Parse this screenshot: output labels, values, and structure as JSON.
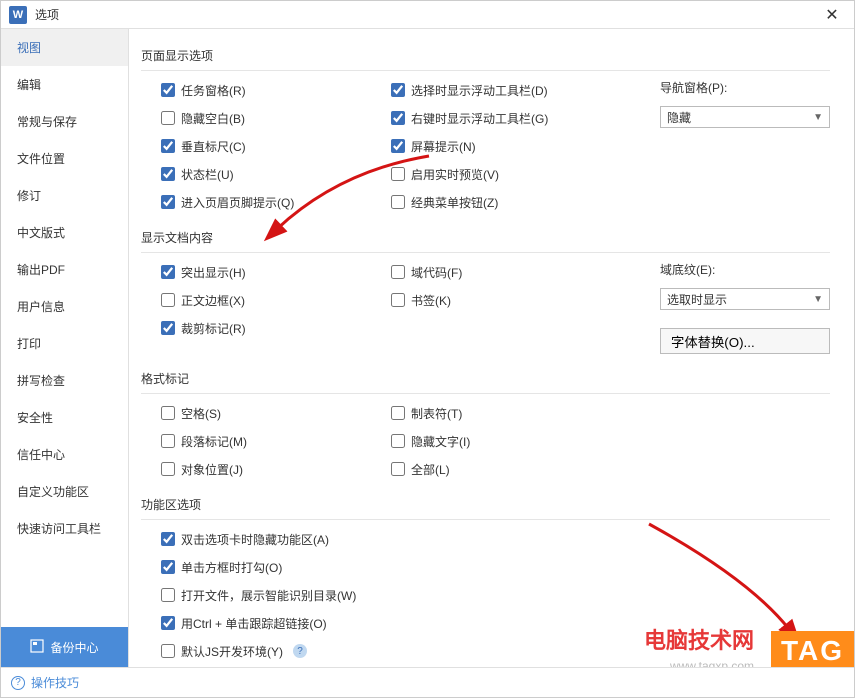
{
  "titlebar": {
    "app_letter": "W",
    "title": "选项",
    "close": "✕"
  },
  "sidebar": {
    "items": [
      {
        "label": "视图",
        "active": true
      },
      {
        "label": "编辑"
      },
      {
        "label": "常规与保存"
      },
      {
        "label": "文件位置"
      },
      {
        "label": "修订"
      },
      {
        "label": "中文版式"
      },
      {
        "label": "输出PDF"
      },
      {
        "label": "用户信息"
      },
      {
        "label": "打印"
      },
      {
        "label": "拼写检查"
      },
      {
        "label": "安全性"
      },
      {
        "label": "信任中心"
      },
      {
        "label": "自定义功能区"
      },
      {
        "label": "快速访问工具栏"
      }
    ],
    "backup": "备份中心"
  },
  "sections": {
    "page_display": {
      "title": "页面显示选项",
      "col1": [
        {
          "label": "任务窗格(R)",
          "checked": true
        },
        {
          "label": "隐藏空白(B)",
          "checked": false
        },
        {
          "label": "垂直标尺(C)",
          "checked": true
        },
        {
          "label": "状态栏(U)",
          "checked": true
        },
        {
          "label": "进入页眉页脚提示(Q)",
          "checked": true
        }
      ],
      "col2": [
        {
          "label": "选择时显示浮动工具栏(D)",
          "checked": true
        },
        {
          "label": "右键时显示浮动工具栏(G)",
          "checked": true
        },
        {
          "label": "屏幕提示(N)",
          "checked": true
        },
        {
          "label": "启用实时预览(V)",
          "checked": false
        },
        {
          "label": "经典菜单按钮(Z)",
          "checked": false
        }
      ],
      "nav_label": "导航窗格(P):",
      "nav_value": "隐藏"
    },
    "doc_content": {
      "title": "显示文档内容",
      "col1": [
        {
          "label": "突出显示(H)",
          "checked": true
        },
        {
          "label": "正文边框(X)",
          "checked": false
        },
        {
          "label": "裁剪标记(R)",
          "checked": true
        }
      ],
      "col2": [
        {
          "label": "域代码(F)",
          "checked": false
        },
        {
          "label": "书签(K)",
          "checked": false
        }
      ],
      "shade_label": "域底纹(E):",
      "shade_value": "选取时显示",
      "font_sub_btn": "字体替换(O)..."
    },
    "format_marks": {
      "title": "格式标记",
      "col1": [
        {
          "label": "空格(S)",
          "checked": false
        },
        {
          "label": "段落标记(M)",
          "checked": false
        },
        {
          "label": "对象位置(J)",
          "checked": false
        }
      ],
      "col2": [
        {
          "label": "制表符(T)",
          "checked": false
        },
        {
          "label": "隐藏文字(I)",
          "checked": false
        },
        {
          "label": "全部(L)",
          "checked": false
        }
      ]
    },
    "ribbon": {
      "title": "功能区选项",
      "items": [
        {
          "label": "双击选项卡时隐藏功能区(A)",
          "checked": true
        },
        {
          "label": "单击方框时打勾(O)",
          "checked": true
        },
        {
          "label": "打开文件，展示智能识别目录(W)",
          "checked": false
        },
        {
          "label": "用Ctrl + 单击跟踪超链接(O)",
          "checked": true
        },
        {
          "label": "默认JS开发环境(Y)",
          "checked": false,
          "info": true
        }
      ]
    }
  },
  "footer": {
    "tips": "操作技巧"
  },
  "watermark": {
    "main": "电脑技术网",
    "sub": "www.tagxp.com",
    "tag": "TAG"
  }
}
